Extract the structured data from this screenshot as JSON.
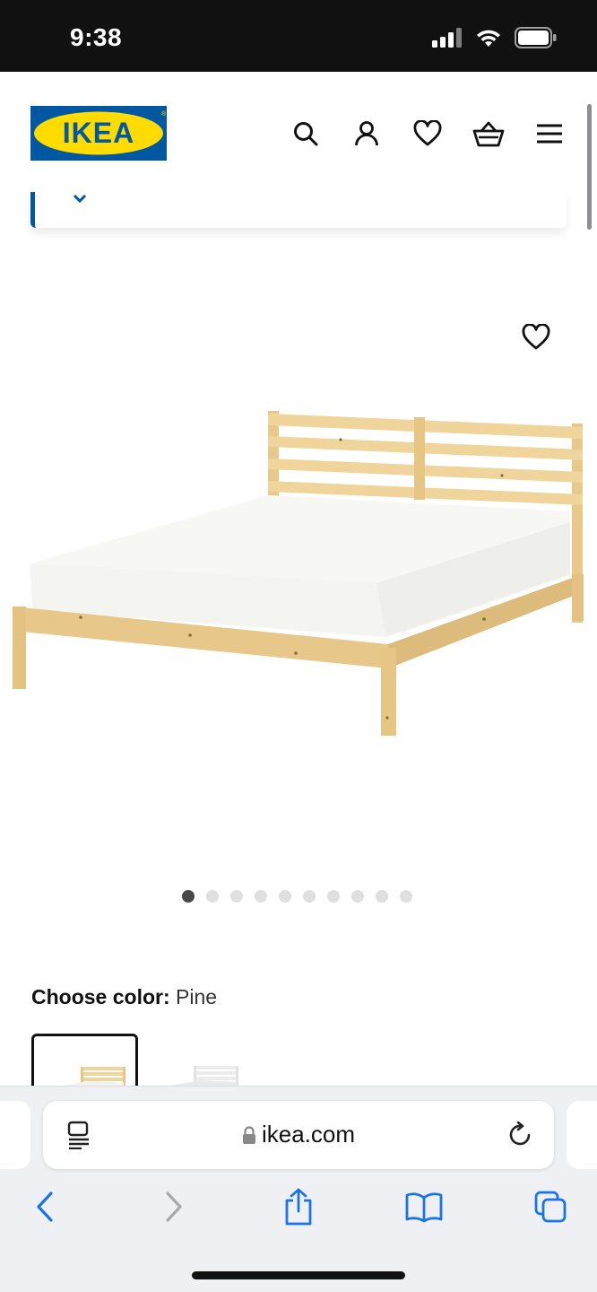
{
  "status_bar": {
    "time": "9:38"
  },
  "header": {
    "logo_text": "IKEA",
    "brand_colors": {
      "blue": "#0058a3",
      "yellow": "#ffdb00"
    },
    "icons": [
      "search-icon",
      "account-icon",
      "heart-icon",
      "basket-icon",
      "menu-icon"
    ]
  },
  "product": {
    "image": "bed-frame-pine",
    "carousel": {
      "total": 10,
      "active": 1
    }
  },
  "color_chooser": {
    "label": "Choose color:",
    "selected": "Pine",
    "swatches": [
      {
        "name": "pine",
        "selected": true
      },
      {
        "name": "white",
        "selected": false
      }
    ]
  },
  "browser": {
    "url": "ikea.com",
    "icons": [
      "reader-icon",
      "lock-icon",
      "reload-icon",
      "back-icon",
      "forward-icon",
      "share-icon",
      "bookmarks-icon",
      "tabs-icon"
    ],
    "accent": "#1a73e8"
  }
}
